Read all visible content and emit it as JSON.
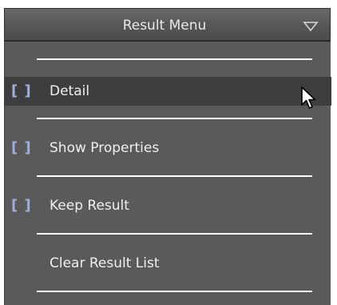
{
  "menu": {
    "title": "Result Menu",
    "dropdown_icon": "triangle-down-icon",
    "items": [
      {
        "checkbox": "[ ]",
        "label": "Detail",
        "highlighted": true
      },
      {
        "checkbox": "[ ]",
        "label": "Show Properties",
        "highlighted": false
      },
      {
        "checkbox": "[ ]",
        "label": "Keep Result",
        "highlighted": false
      },
      {
        "checkbox": "",
        "label": "Clear Result List",
        "highlighted": false
      }
    ]
  },
  "cursor": {
    "icon": "arrow-cursor-icon"
  },
  "colors": {
    "header_bg": "#595959",
    "body_bg": "#5a5a5a",
    "highlight_bg": "#3e3e3e",
    "bracket": "#9fb0df",
    "text": "#efefef",
    "divider": "#ffffff"
  }
}
